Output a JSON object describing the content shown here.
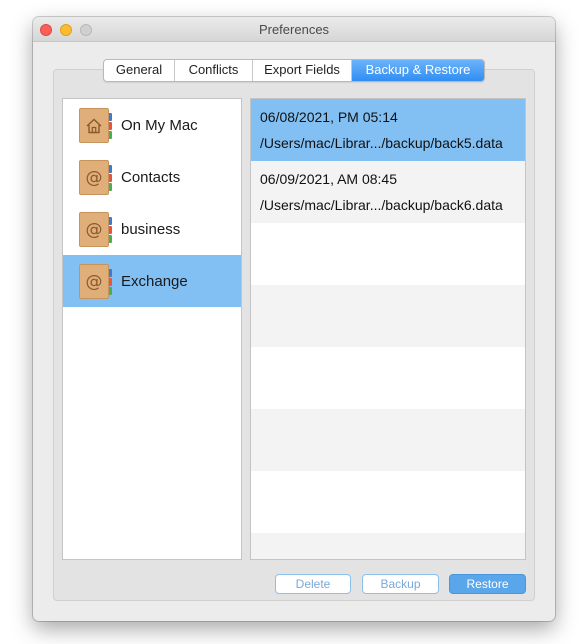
{
  "window": {
    "title": "Preferences"
  },
  "tabs": [
    {
      "label": "General",
      "active": false
    },
    {
      "label": "Conflicts",
      "active": false
    },
    {
      "label": "Export Fields",
      "active": false
    },
    {
      "label": "Backup & Restore",
      "active": true
    }
  ],
  "sources": [
    {
      "label": "On My Mac",
      "icon": "house-icon",
      "selected": false
    },
    {
      "label": "Contacts",
      "icon": "at-icon",
      "selected": false
    },
    {
      "label": "business",
      "icon": "at-icon",
      "selected": false
    },
    {
      "label": "Exchange",
      "icon": "at-icon",
      "selected": true
    }
  ],
  "backups": [
    {
      "date": "06/08/2021, PM 05:14",
      "path": "/Users/mac/Librar.../backup/back5.data",
      "selected": true
    },
    {
      "date": "06/09/2021, AM 08:45",
      "path": "/Users/mac/Librar.../backup/back6.data",
      "selected": false
    }
  ],
  "buttons": {
    "delete": "Delete",
    "backup": "Backup",
    "restore": "Restore"
  },
  "colors": {
    "selection": "#82c0f4",
    "accent": "#2f8ef3",
    "book": "#dfae79"
  },
  "icons": {
    "at_glyph": "@"
  }
}
